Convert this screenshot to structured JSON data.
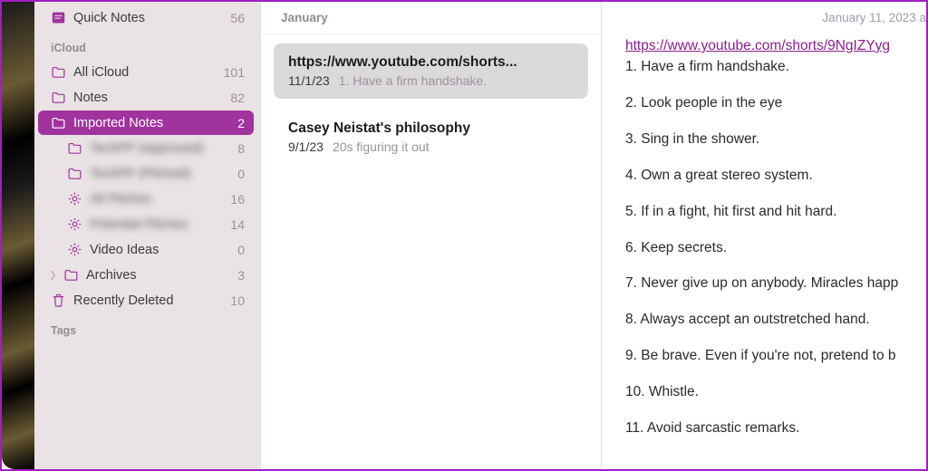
{
  "sidebar": {
    "quick_notes": {
      "label": "Quick Notes",
      "count": 56
    },
    "sections": [
      {
        "heading": "iCloud",
        "items": [
          {
            "icon": "folder",
            "label": "All iCloud",
            "count": 101,
            "selected": false
          },
          {
            "icon": "folder",
            "label": "Notes",
            "count": 82,
            "selected": false
          },
          {
            "icon": "folder",
            "label": "Imported Notes",
            "count": 2,
            "selected": true
          },
          {
            "icon": "folder",
            "label": "TechPP (Approved)",
            "count": 8,
            "indent": true,
            "blur": true
          },
          {
            "icon": "folder",
            "label": "TechPP (Pitched)",
            "count": 0,
            "indent": true,
            "blur": true
          },
          {
            "icon": "gear",
            "label": "All Pitches",
            "count": 16,
            "indent": true,
            "blur": true
          },
          {
            "icon": "gear",
            "label": "Potential Pitches",
            "count": 14,
            "indent": true,
            "blur": true
          },
          {
            "icon": "gear",
            "label": "Video Ideas",
            "count": 0,
            "indent": true
          },
          {
            "icon": "folder",
            "label": "Archives",
            "count": 3,
            "disclosure": true
          },
          {
            "icon": "trash",
            "label": "Recently Deleted",
            "count": 10
          }
        ]
      }
    ],
    "tags_heading": "Tags"
  },
  "notes_list": {
    "month": "January",
    "items": [
      {
        "title": "https://www.youtube.com/shorts...",
        "date": "11/1/23",
        "preview": "1. Have a firm handshake.",
        "selected": true
      },
      {
        "title": "Casey Neistat's philosophy",
        "date": "9/1/23",
        "preview": "20s figuring it out",
        "selected": false
      }
    ]
  },
  "detail": {
    "date": "January 11, 2023 a",
    "link_text": "https://www.youtube.com/shorts/9NgIZYyg",
    "body": [
      "1. Have a firm handshake.",
      "2. Look people in the eye",
      "3. Sing in the shower.",
      "4. Own a great stereo system.",
      "5. If in a fight, hit first and hit hard.",
      "6. Keep secrets.",
      "7. Never give up on anybody. Miracles happ",
      "8. Always accept an outstretched hand.",
      "9. Be brave. Even if you're not, pretend to b",
      "10. Whistle.",
      "11. Avoid sarcastic remarks."
    ]
  }
}
